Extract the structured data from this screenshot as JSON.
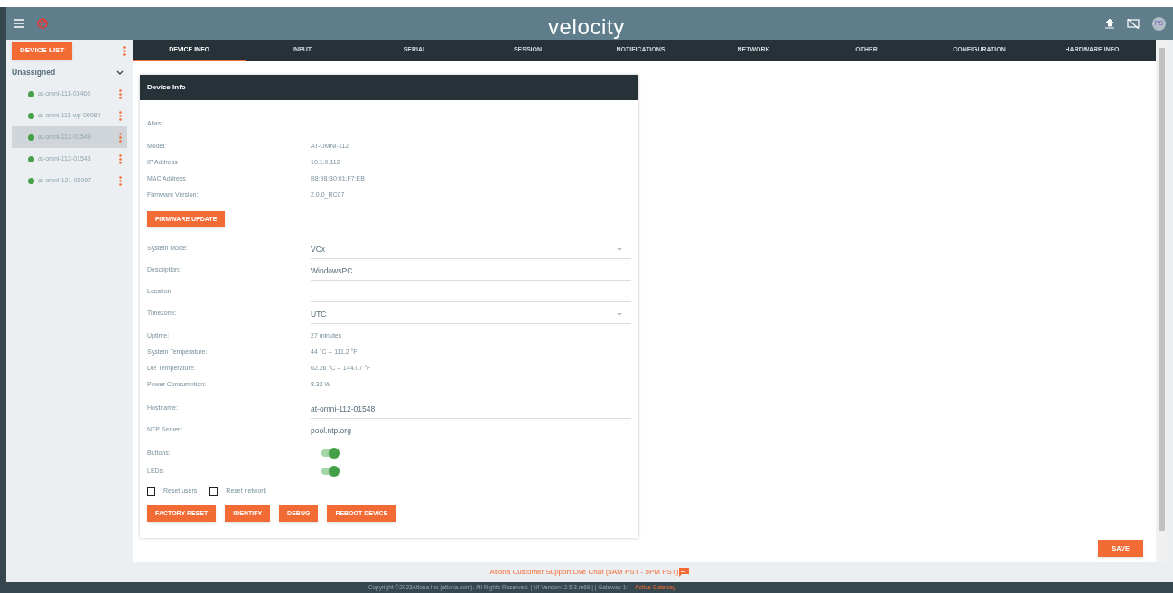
{
  "header": {
    "logo": "velocity",
    "avatar": "PS"
  },
  "sidebar": {
    "device_list_button": "DEVICE LIST",
    "group": {
      "label": "Unassigned",
      "expanded": true
    },
    "items": [
      {
        "label": "at-omni-111-01466",
        "selected": false,
        "color": "#43a047"
      },
      {
        "label": "at-omni-111-wp-00084",
        "selected": false,
        "color": "#43a047"
      },
      {
        "label": "at-omni-112-01548",
        "selected": true,
        "color": "#43a047"
      },
      {
        "label": "at-omni-112-01548",
        "selected": false,
        "color": "#43a047"
      },
      {
        "label": "at-omni-121-02097",
        "selected": false,
        "color": "#43a047"
      }
    ]
  },
  "tabs": [
    {
      "label": "DEVICE INFO",
      "selected": true
    },
    {
      "label": "INPUT",
      "selected": false
    },
    {
      "label": "SERIAL",
      "selected": false
    },
    {
      "label": "SESSION",
      "selected": false
    },
    {
      "label": "NOTIFICATIONS",
      "selected": false
    },
    {
      "label": "NETWORK",
      "selected": false
    },
    {
      "label": "OTHER",
      "selected": false
    },
    {
      "label": "CONFIGURATION",
      "selected": false
    },
    {
      "label": "HARDWARE INFO",
      "selected": false
    }
  ],
  "card": {
    "title": "Device Info",
    "items": [
      {
        "kind": "field",
        "label": "Alias:"
      },
      {
        "kind": "info",
        "label": "Model:",
        "value": "AT-OMNI-112"
      },
      {
        "kind": "info",
        "label": "IP Address",
        "value": "10.1.0.112"
      },
      {
        "kind": "info",
        "label": "MAC Address",
        "value": "B8:98:B0:01:F7:EB"
      },
      {
        "kind": "info",
        "label": "Firmware Version:",
        "value": "2.0.0_RC07"
      },
      {
        "kind": "buttons",
        "buttons": [
          "FIRMWARE UPDATE"
        ]
      },
      {
        "kind": "select",
        "label": "System Mode:",
        "value": "VCx"
      },
      {
        "kind": "field",
        "label": "Description:",
        "value": "WindowsPC"
      },
      {
        "kind": "field",
        "label": "Location:"
      },
      {
        "kind": "select",
        "label": "Timezone:",
        "value": "UTC"
      },
      {
        "kind": "info",
        "label": "Uptime:",
        "value": "27 minutes"
      },
      {
        "kind": "info",
        "label": "System Temperature:",
        "value": "44 °C -- 111.2 °F"
      },
      {
        "kind": "info",
        "label": "Die Temperature:",
        "value": "62.26 °C -- 144.07 °F"
      },
      {
        "kind": "info",
        "label": "Power Consumption:",
        "value": "8.32 W"
      },
      {
        "kind": "field",
        "label": "Hostname:",
        "value": "at-omni-112-01548"
      },
      {
        "kind": "field",
        "label": "NTP Server:",
        "value": "pool.ntp.org"
      },
      {
        "kind": "toggle",
        "label": "Buttons:",
        "on": true
      },
      {
        "kind": "toggle",
        "label": "LEDs:",
        "on": true
      },
      {
        "kind": "checkboxes",
        "options": [
          {
            "label": "Reset users",
            "checked": false
          },
          {
            "label": "Reset network",
            "checked": false
          }
        ]
      },
      {
        "kind": "buttons",
        "buttons": [
          "FACTORY RESET",
          "IDENTIFY",
          "DEBUG",
          "REBOOT DEVICE"
        ]
      }
    ]
  },
  "save_button": "SAVE",
  "support_link": "Atlona Customer Support Live Chat (5AM PST - 5PM PST)",
  "footer": {
    "copyright": "Copyright ©2023Atlona Inc (atlona.com). All Rights Reserved. | UI Version: 2.5.3.m69 | | Gateway 1:",
    "gateway_status": "Active Gateway"
  }
}
